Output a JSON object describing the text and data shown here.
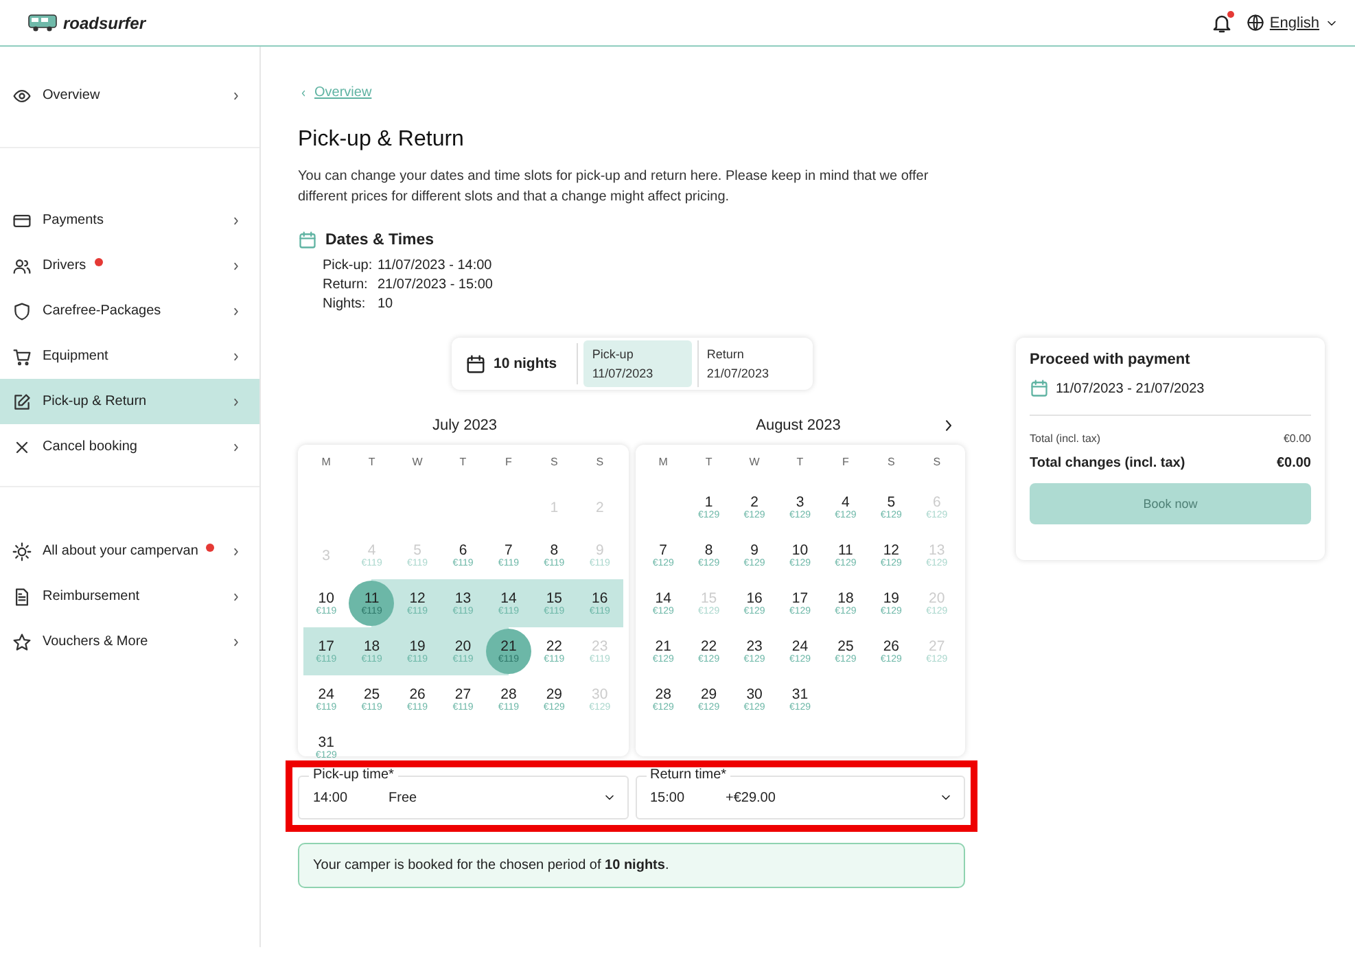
{
  "header": {
    "logo": "roadsurfer",
    "has_notification": true,
    "language": "English"
  },
  "sidebar": {
    "groups": [
      [
        {
          "label": "Overview",
          "selected": false,
          "alert": false
        }
      ],
      [
        {
          "label": "Payments",
          "selected": false,
          "alert": false
        },
        {
          "label": "Drivers",
          "selected": false,
          "alert": true
        },
        {
          "label": "Carefree-Packages",
          "selected": false,
          "alert": false
        },
        {
          "label": "Equipment",
          "selected": false,
          "alert": false
        },
        {
          "label": "Pick-up & Return",
          "selected": true,
          "alert": false
        },
        {
          "label": "Cancel booking",
          "selected": false,
          "alert": false
        }
      ],
      [
        {
          "label": "All about your campervan",
          "selected": false,
          "alert": true
        },
        {
          "label": "Reimbursement",
          "selected": false,
          "alert": false
        },
        {
          "label": "Vouchers & More",
          "selected": false,
          "alert": false
        }
      ]
    ]
  },
  "breadcrumb": "Overview",
  "title": "Pick-up & Return",
  "intro": "You can change your dates and time slots for pick-up and return here. Please keep in mind that we offer different prices for different slots and that a change might affect pricing.",
  "dates_times": {
    "heading": "Dates & Times",
    "rows": [
      {
        "label": "Pick-up:",
        "value": "11/07/2023 - 14:00"
      },
      {
        "label": "Return:",
        "value": "21/07/2023 - 15:00"
      },
      {
        "label": "Nights:",
        "value": "10"
      }
    ]
  },
  "selector": {
    "nights": "10 nights",
    "fields": [
      {
        "label": "Pick-up",
        "value": "11/07/2023",
        "selected": true
      },
      {
        "label": "Return",
        "value": "21/07/2023",
        "selected": false
      }
    ]
  },
  "calendar": {
    "months": [
      {
        "title": "July 2023",
        "weekdays": [
          "M",
          "T",
          "W",
          "T",
          "F",
          "S",
          "S"
        ],
        "weeks": [
          [
            {
              "kind": "blank"
            },
            {
              "kind": "blank"
            },
            {
              "kind": "blank"
            },
            {
              "kind": "blank"
            },
            {
              "kind": "blank"
            },
            {
              "kind": "day",
              "day": "1",
              "disabled": true,
              "selected": false,
              "in_range": false
            },
            {
              "kind": "day",
              "day": "2",
              "disabled": true,
              "selected": false,
              "in_range": false
            }
          ],
          [
            {
              "kind": "day",
              "day": "3",
              "disabled": true,
              "selected": false,
              "in_range": false
            },
            {
              "kind": "day",
              "day": "4",
              "price": "€119",
              "disabled": true,
              "selected": false,
              "in_range": false
            },
            {
              "kind": "day",
              "day": "5",
              "price": "€119",
              "disabled": true,
              "selected": false,
              "in_range": false
            },
            {
              "kind": "day",
              "day": "6",
              "price": "€119",
              "disabled": false,
              "selected": false,
              "in_range": false
            },
            {
              "kind": "day",
              "day": "7",
              "price": "€119",
              "disabled": false,
              "selected": false,
              "in_range": false
            },
            {
              "kind": "day",
              "day": "8",
              "price": "€119",
              "disabled": false,
              "selected": false,
              "in_range": false
            },
            {
              "kind": "day",
              "day": "9",
              "price": "€119",
              "disabled": true,
              "selected": false,
              "in_range": false
            }
          ],
          [
            {
              "kind": "day",
              "day": "10",
              "price": "€119",
              "disabled": false,
              "selected": false,
              "in_range": false
            },
            {
              "kind": "day",
              "day": "11",
              "price": "€119",
              "disabled": false,
              "selected": true,
              "in_range": true
            },
            {
              "kind": "day",
              "day": "12",
              "price": "€119",
              "disabled": false,
              "selected": false,
              "in_range": true
            },
            {
              "kind": "day",
              "day": "13",
              "price": "€119",
              "disabled": false,
              "selected": false,
              "in_range": true
            },
            {
              "kind": "day",
              "day": "14",
              "price": "€119",
              "disabled": false,
              "selected": false,
              "in_range": true
            },
            {
              "kind": "day",
              "day": "15",
              "price": "€119",
              "disabled": false,
              "selected": false,
              "in_range": true
            },
            {
              "kind": "day",
              "day": "16",
              "price": "€119",
              "disabled": false,
              "selected": false,
              "in_range": true
            }
          ],
          [
            {
              "kind": "day",
              "day": "17",
              "price": "€119",
              "disabled": false,
              "selected": false,
              "in_range": true
            },
            {
              "kind": "day",
              "day": "18",
              "price": "€119",
              "disabled": false,
              "selected": false,
              "in_range": true
            },
            {
              "kind": "day",
              "day": "19",
              "price": "€119",
              "disabled": false,
              "selected": false,
              "in_range": true
            },
            {
              "kind": "day",
              "day": "20",
              "price": "€119",
              "disabled": false,
              "selected": false,
              "in_range": true
            },
            {
              "kind": "day",
              "day": "21",
              "price": "€119",
              "disabled": false,
              "selected": true,
              "in_range": true
            },
            {
              "kind": "day",
              "day": "22",
              "price": "€119",
              "disabled": false,
              "selected": false,
              "in_range": false
            },
            {
              "kind": "day",
              "day": "23",
              "price": "€119",
              "disabled": true,
              "selected": false,
              "in_range": false
            }
          ],
          [
            {
              "kind": "day",
              "day": "24",
              "price": "€119",
              "disabled": false,
              "selected": false,
              "in_range": false
            },
            {
              "kind": "day",
              "day": "25",
              "price": "€119",
              "disabled": false,
              "selected": false,
              "in_range": false
            },
            {
              "kind": "day",
              "day": "26",
              "price": "€119",
              "disabled": false,
              "selected": false,
              "in_range": false
            },
            {
              "kind": "day",
              "day": "27",
              "price": "€119",
              "disabled": false,
              "selected": false,
              "in_range": false
            },
            {
              "kind": "day",
              "day": "28",
              "price": "€119",
              "disabled": false,
              "selected": false,
              "in_range": false
            },
            {
              "kind": "day",
              "day": "29",
              "price": "€129",
              "disabled": false,
              "selected": false,
              "in_range": false
            },
            {
              "kind": "day",
              "day": "30",
              "price": "€129",
              "disabled": true,
              "selected": false,
              "in_range": false
            }
          ],
          [
            {
              "kind": "day",
              "day": "31",
              "price": "€129",
              "disabled": false,
              "selected": false,
              "in_range": false
            }
          ]
        ]
      },
      {
        "title": "August 2023",
        "weekdays": [
          "M",
          "T",
          "W",
          "T",
          "F",
          "S",
          "S"
        ],
        "weeks": [
          [
            {
              "kind": "blank"
            },
            {
              "kind": "day",
              "day": "1",
              "price": "€129",
              "disabled": false,
              "selected": false,
              "in_range": false
            },
            {
              "kind": "day",
              "day": "2",
              "price": "€129",
              "disabled": false,
              "selected": false,
              "in_range": false
            },
            {
              "kind": "day",
              "day": "3",
              "price": "€129",
              "disabled": false,
              "selected": false,
              "in_range": false
            },
            {
              "kind": "day",
              "day": "4",
              "price": "€129",
              "disabled": false,
              "selected": false,
              "in_range": false
            },
            {
              "kind": "day",
              "day": "5",
              "price": "€129",
              "disabled": false,
              "selected": false,
              "in_range": false
            },
            {
              "kind": "day",
              "day": "6",
              "price": "€129",
              "disabled": true,
              "selected": false,
              "in_range": false
            }
          ],
          [
            {
              "kind": "day",
              "day": "7",
              "price": "€129",
              "disabled": false,
              "selected": false,
              "in_range": false
            },
            {
              "kind": "day",
              "day": "8",
              "price": "€129",
              "disabled": false,
              "selected": false,
              "in_range": false
            },
            {
              "kind": "day",
              "day": "9",
              "price": "€129",
              "disabled": false,
              "selected": false,
              "in_range": false
            },
            {
              "kind": "day",
              "day": "10",
              "price": "€129",
              "disabled": false,
              "selected": false,
              "in_range": false
            },
            {
              "kind": "day",
              "day": "11",
              "price": "€129",
              "disabled": false,
              "selected": false,
              "in_range": false
            },
            {
              "kind": "day",
              "day": "12",
              "price": "€129",
              "disabled": false,
              "selected": false,
              "in_range": false
            },
            {
              "kind": "day",
              "day": "13",
              "price": "€129",
              "disabled": true,
              "selected": false,
              "in_range": false
            }
          ],
          [
            {
              "kind": "day",
              "day": "14",
              "price": "€129",
              "disabled": false,
              "selected": false,
              "in_range": false
            },
            {
              "kind": "day",
              "day": "15",
              "price": "€129",
              "disabled": true,
              "selected": false,
              "in_range": false
            },
            {
              "kind": "day",
              "day": "16",
              "price": "€129",
              "disabled": false,
              "selected": false,
              "in_range": false
            },
            {
              "kind": "day",
              "day": "17",
              "price": "€129",
              "disabled": false,
              "selected": false,
              "in_range": false
            },
            {
              "kind": "day",
              "day": "18",
              "price": "€129",
              "disabled": false,
              "selected": false,
              "in_range": false
            },
            {
              "kind": "day",
              "day": "19",
              "price": "€129",
              "disabled": false,
              "selected": false,
              "in_range": false
            },
            {
              "kind": "day",
              "day": "20",
              "price": "€129",
              "disabled": true,
              "selected": false,
              "in_range": false
            }
          ],
          [
            {
              "kind": "day",
              "day": "21",
              "price": "€129",
              "disabled": false,
              "selected": false,
              "in_range": false
            },
            {
              "kind": "day",
              "day": "22",
              "price": "€129",
              "disabled": false,
              "selected": false,
              "in_range": false
            },
            {
              "kind": "day",
              "day": "23",
              "price": "€129",
              "disabled": false,
              "selected": false,
              "in_range": false
            },
            {
              "kind": "day",
              "day": "24",
              "price": "€129",
              "disabled": false,
              "selected": false,
              "in_range": false
            },
            {
              "kind": "day",
              "day": "25",
              "price": "€129",
              "disabled": false,
              "selected": false,
              "in_range": false
            },
            {
              "kind": "day",
              "day": "26",
              "price": "€129",
              "disabled": false,
              "selected": false,
              "in_range": false
            },
            {
              "kind": "day",
              "day": "27",
              "price": "€129",
              "disabled": true,
              "selected": false,
              "in_range": false
            }
          ],
          [
            {
              "kind": "day",
              "day": "28",
              "price": "€129",
              "disabled": false,
              "selected": false,
              "in_range": false
            },
            {
              "kind": "day",
              "day": "29",
              "price": "€129",
              "disabled": false,
              "selected": false,
              "in_range": false
            },
            {
              "kind": "day",
              "day": "30",
              "price": "€129",
              "disabled": false,
              "selected": false,
              "in_range": false
            },
            {
              "kind": "day",
              "day": "31",
              "price": "€129",
              "disabled": false,
              "selected": false,
              "in_range": false
            }
          ]
        ]
      }
    ]
  },
  "time_slots": {
    "highlighted": true,
    "fields": [
      {
        "label": "Pick-up time*",
        "time": "14:00",
        "price": "Free"
      },
      {
        "label": "Return time*",
        "time": "15:00",
        "price": "+€29.00"
      }
    ]
  },
  "notice": "Your camper is booked for the chosen period of **10 nights**.",
  "summary": {
    "title": "Proceed with payment",
    "dates": "11/07/2023 - 21/07/2023",
    "rows": [
      {
        "kind": "subtotal",
        "label": "Total (incl. tax)",
        "value": "€0.00"
      },
      {
        "kind": "total",
        "label": "Total changes (incl. tax)",
        "value": "€0.00"
      }
    ],
    "button": {
      "label": "Book now",
      "disabled": true
    }
  }
}
